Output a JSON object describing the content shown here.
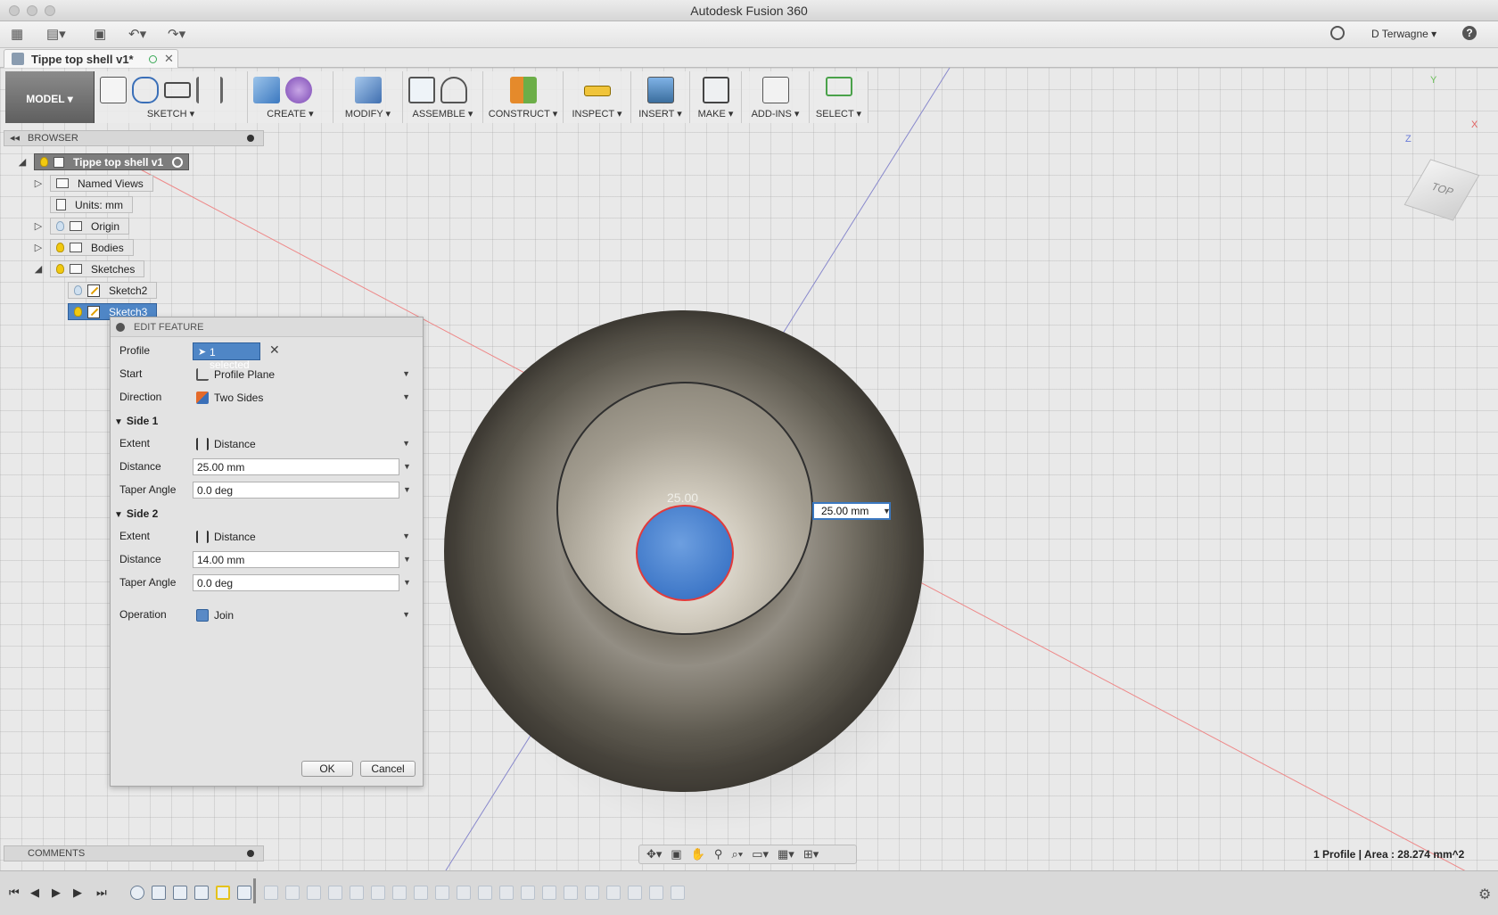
{
  "app": {
    "title": "Autodesk Fusion 360",
    "user": "D Terwagne ▾",
    "help": "?"
  },
  "document": {
    "tab_title": "Tippe top shell v1*"
  },
  "toolbar": {
    "workspace": "MODEL ▾",
    "groups": [
      "SKETCH ▾",
      "CREATE ▾",
      "MODIFY ▾",
      "ASSEMBLE ▾",
      "CONSTRUCT ▾",
      "INSPECT ▾",
      "INSERT ▾",
      "MAKE ▾",
      "ADD-INS ▾",
      "SELECT ▾"
    ]
  },
  "browser": {
    "header": "BROWSER",
    "items": [
      {
        "label": "Tippe top shell v1"
      },
      {
        "label": "Named Views"
      },
      {
        "label": "Units: mm"
      },
      {
        "label": "Origin"
      },
      {
        "label": "Bodies"
      },
      {
        "label": "Sketches"
      },
      {
        "label": "Sketch2"
      },
      {
        "label": "Sketch3"
      }
    ]
  },
  "dialog": {
    "title": "EDIT FEATURE",
    "profile_label": "Profile",
    "profile_value": "1 selected",
    "start_label": "Start",
    "start_value": "Profile Plane",
    "direction_label": "Direction",
    "direction_value": "Two Sides",
    "side1": {
      "title": "Side 1",
      "extent_label": "Extent",
      "extent_value": "Distance",
      "distance_label": "Distance",
      "distance_value": "25.00 mm",
      "taper_label": "Taper Angle",
      "taper_value": "0.0 deg"
    },
    "side2": {
      "title": "Side 2",
      "extent_label": "Extent",
      "extent_value": "Distance",
      "distance_label": "Distance",
      "distance_value": "14.00 mm",
      "taper_label": "Taper Angle",
      "taper_value": "0.0 deg"
    },
    "operation_label": "Operation",
    "operation_value": "Join",
    "ok_label": "OK",
    "cancel_label": "Cancel"
  },
  "canvas": {
    "dimension_text": "25.00",
    "dimension_input": "25.00 mm",
    "viewcube_label": "TOP",
    "axis_x": "X",
    "axis_y": "Y",
    "axis_z": "Z"
  },
  "comments": {
    "header": "COMMENTS"
  },
  "status": {
    "text": "1 Profile | Area : 28.274 mm^2"
  }
}
